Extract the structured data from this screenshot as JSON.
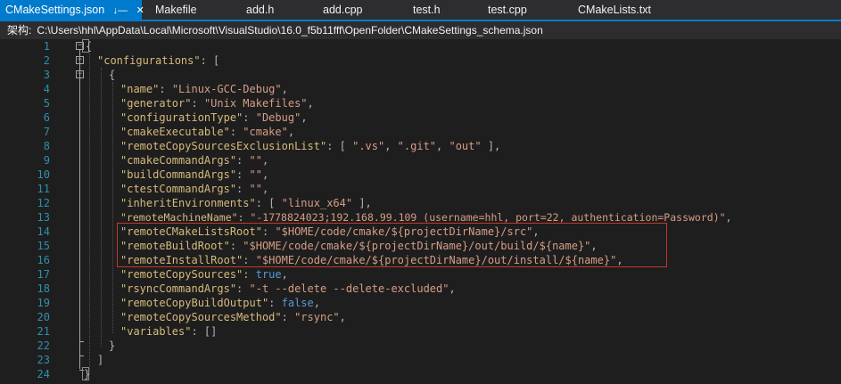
{
  "tabs": [
    {
      "label": "CMakeSettings.json",
      "active": true
    },
    {
      "label": "Makefile"
    },
    {
      "label": "add.h"
    },
    {
      "label": "add.cpp"
    },
    {
      "label": "test.h"
    },
    {
      "label": "test.cpp"
    },
    {
      "label": "CMakeLists.txt"
    }
  ],
  "active_tab_icons": {
    "pin": "pin-icon",
    "close": "close-icon"
  },
  "pathbar": {
    "label": "架构:",
    "path": "C:\\Users\\hhl\\AppData\\Local\\Microsoft\\VisualStudio\\16.0_f5b11fff\\OpenFolder\\CMakeSettings_schema.json"
  },
  "line_numbers": [
    "1",
    "2",
    "3",
    "4",
    "5",
    "6",
    "7",
    "8",
    "9",
    "10",
    "11",
    "12",
    "13",
    "14",
    "15",
    "16",
    "17",
    "18",
    "19",
    "20",
    "21",
    "22",
    "23",
    "24"
  ],
  "code": {
    "l1": {
      "p1": "{"
    },
    "l2": {
      "k": "\"configurations\"",
      "p": ": ["
    },
    "l3": {
      "p": "{"
    },
    "l4": {
      "k": "\"name\"",
      "p": ": ",
      "v": "\"Linux-GCC-Debug\"",
      "e": ","
    },
    "l5": {
      "k": "\"generator\"",
      "p": ": ",
      "v": "\"Unix Makefiles\"",
      "e": ","
    },
    "l6": {
      "k": "\"configurationType\"",
      "p": ": ",
      "v": "\"Debug\"",
      "e": ","
    },
    "l7": {
      "k": "\"cmakeExecutable\"",
      "p": ": ",
      "v": "\"cmake\"",
      "e": ","
    },
    "l8": {
      "k": "\"remoteCopySourcesExclusionList\"",
      "p": ": [ ",
      "v1": "\".vs\"",
      "c1": ", ",
      "v2": "\".git\"",
      "c2": ", ",
      "v3": "\"out\"",
      "e": " ],"
    },
    "l9": {
      "k": "\"cmakeCommandArgs\"",
      "p": ": ",
      "v": "\"\"",
      "e": ","
    },
    "l10": {
      "k": "\"buildCommandArgs\"",
      "p": ": ",
      "v": "\"\"",
      "e": ","
    },
    "l11": {
      "k": "\"ctestCommandArgs\"",
      "p": ": ",
      "v": "\"\"",
      "e": ","
    },
    "l12": {
      "k": "\"inheritEnvironments\"",
      "p": ": [ ",
      "v": "\"linux_x64\"",
      "e": " ],"
    },
    "l13": {
      "k": "\"remoteMachineName\"",
      "p": ": ",
      "v": "\"-1778824023;192.168.99.109 (username=hhl, port=22, authentication=Password)\"",
      "e": ","
    },
    "l14": {
      "k": "\"remoteCMakeListsRoot\"",
      "p": ": ",
      "v": "\"$HOME/code/cmake/${projectDirName}/src\"",
      "e": ","
    },
    "l15": {
      "k": "\"remoteBuildRoot\"",
      "p": ": ",
      "v": "\"$HOME/code/cmake/${projectDirName}/out/build/${name}\"",
      "e": ","
    },
    "l16": {
      "k": "\"remoteInstallRoot\"",
      "p": ": ",
      "v": "\"$HOME/code/cmake/${projectDirName}/out/install/${name}\"",
      "e": ","
    },
    "l17": {
      "k": "\"remoteCopySources\"",
      "p": ": ",
      "v": "true",
      "e": ","
    },
    "l18": {
      "k": "\"rsyncCommandArgs\"",
      "p": ": ",
      "v": "\"-t --delete --delete-excluded\"",
      "e": ","
    },
    "l19": {
      "k": "\"remoteCopyBuildOutput\"",
      "p": ": ",
      "v": "false",
      "e": ","
    },
    "l20": {
      "k": "\"remoteCopySourcesMethod\"",
      "p": ": ",
      "v": "\"rsync\"",
      "e": ","
    },
    "l21": {
      "k": "\"variables\"",
      "p": ": []"
    },
    "l22": {
      "p": "}"
    },
    "l23": {
      "p": "]"
    },
    "l24": {
      "p": "}"
    }
  },
  "colors": {
    "tab_active": "#007acc",
    "key": "#d7ba7d",
    "string": "#d69d85",
    "keyword": "#569cd6",
    "line_number": "#2b91af",
    "highlight_box": "#c0392b"
  }
}
